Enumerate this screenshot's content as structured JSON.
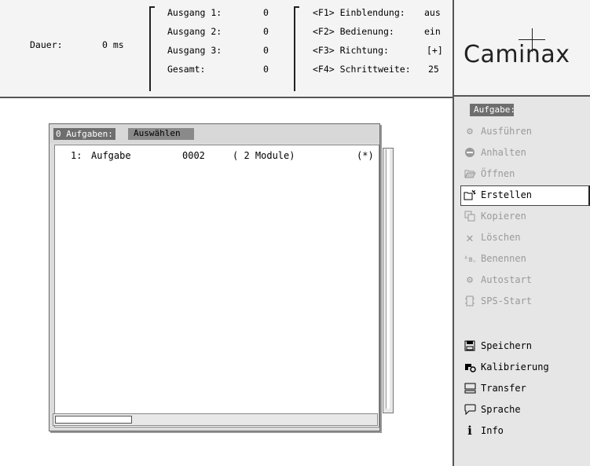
{
  "header": {
    "duration_label": "Dauer:",
    "duration_value": "0 ms",
    "outputs": [
      {
        "label": "Ausgang 1:",
        "value": "0"
      },
      {
        "label": "Ausgang 2:",
        "value": "0"
      },
      {
        "label": "Ausgang 3:",
        "value": "0"
      },
      {
        "label": "Gesamt:",
        "value": "0"
      }
    ],
    "fkeys": [
      {
        "label": "<F1> Einblendung:",
        "value": "aus"
      },
      {
        "label": "<F2> Bedienung:",
        "value": "ein"
      },
      {
        "label": "<F3> Richtung:",
        "value": "[+]"
      },
      {
        "label": "<F4> Schrittweite:",
        "value": "25"
      }
    ],
    "logo": "Caminax"
  },
  "task_window": {
    "count_tab": "0 Aufgaben:",
    "select_tab": "Auswählen",
    "rows": [
      {
        "index": "1:",
        "name": "Aufgabe",
        "number": "0002",
        "modules": "( 2 Module)",
        "flag": "(*)"
      }
    ]
  },
  "sidebar": {
    "section_label": "Aufgabe:",
    "task_items": [
      {
        "label": "Ausführen",
        "icon": "gear-icon",
        "state": "disabled"
      },
      {
        "label": "Anhalten",
        "icon": "stop-icon",
        "state": "disabled"
      },
      {
        "label": "Öffnen",
        "icon": "folder-open-icon",
        "state": "disabled"
      },
      {
        "label": "Erstellen",
        "icon": "new-folder-icon",
        "state": "selected"
      },
      {
        "label": "Kopieren",
        "icon": "copy-icon",
        "state": "disabled"
      },
      {
        "label": "Löschen",
        "icon": "delete-icon",
        "state": "disabled"
      },
      {
        "label": "Benennen",
        "icon": "rename-icon",
        "state": "disabled"
      },
      {
        "label": "Autostart",
        "icon": "autostart-icon",
        "state": "disabled"
      },
      {
        "label": "SPS-Start",
        "icon": "sps-start-icon",
        "state": "disabled"
      }
    ],
    "system_items": [
      {
        "label": "Speichern",
        "icon": "save-icon"
      },
      {
        "label": "Kalibrierung",
        "icon": "calibration-icon"
      },
      {
        "label": "Transfer",
        "icon": "transfer-icon"
      },
      {
        "label": "Sprache",
        "icon": "speech-bubble-icon"
      },
      {
        "label": "Info",
        "icon": "info-icon"
      }
    ]
  }
}
